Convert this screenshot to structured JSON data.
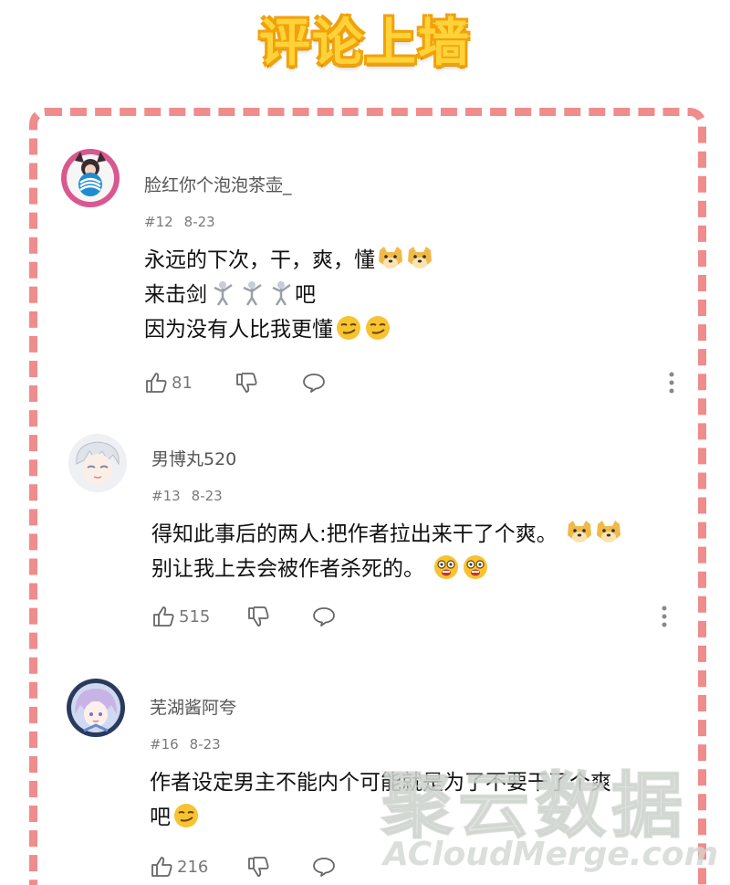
{
  "banner": {
    "title": "评论上墙"
  },
  "comments": [
    {
      "username": "脸红你个泡泡茶壶_",
      "floor": "#12",
      "date": "8-23",
      "lines": [
        "永远的下次，干，爽，懂",
        "来击剑",
        "吧",
        "因为没有人比我更懂"
      ],
      "likes": "81",
      "avatar_icon": "anime-cat-girl-avatar-icon"
    },
    {
      "username": "男博丸520",
      "floor": "#13",
      "date": "8-23",
      "lines": [
        "得知此事后的两人:把作者拉出来干了个爽。",
        "别让我上去会被作者杀死的。"
      ],
      "likes": "515",
      "avatar_icon": "white-hair-boy-avatar-icon"
    },
    {
      "username": "芜湖酱阿夸",
      "floor": "#16",
      "date": "8-23",
      "lines": [
        "作者设定男主不能内个可能就是为了不要干了个爽",
        "吧"
      ],
      "likes": "216",
      "avatar_icon": "purple-hair-girl-avatar-icon"
    }
  ],
  "watermark": {
    "cn": "聚云数据",
    "en": "ACloudMerge.com"
  },
  "colors": {
    "banner": "#ffd23a",
    "frame": "#ef8c8c"
  }
}
